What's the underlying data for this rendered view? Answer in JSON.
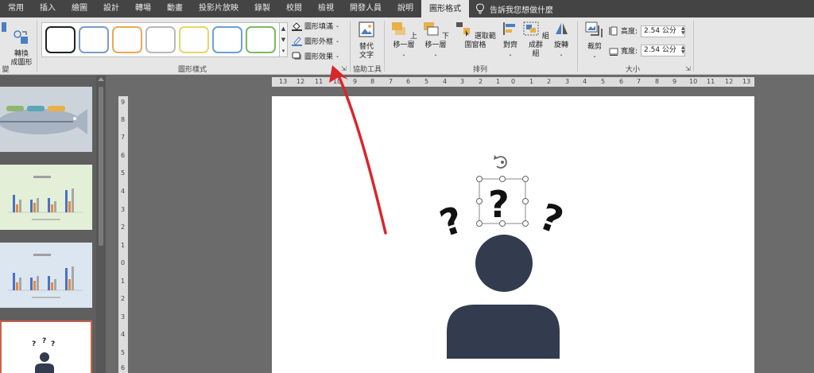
{
  "tabs": [
    {
      "label": "常用"
    },
    {
      "label": "插入"
    },
    {
      "label": "繪圖"
    },
    {
      "label": "設計"
    },
    {
      "label": "轉場"
    },
    {
      "label": "動畫"
    },
    {
      "label": "投影片放映"
    },
    {
      "label": "錄製"
    },
    {
      "label": "校閱"
    },
    {
      "label": "檢視"
    },
    {
      "label": "開發人員"
    },
    {
      "label": "說明"
    },
    {
      "label": "圖形格式",
      "active": true
    }
  ],
  "tell_me": "告訴我您想做什麼",
  "ribbon": {
    "convert_label": "轉換\n成圖形",
    "change_group_label": "變更",
    "gallery_swatch_colors": [
      "#222222",
      "#7a9cc6",
      "#e8a95a",
      "#b9b9b9",
      "#e8d56a",
      "#6da0d6",
      "#7db864"
    ],
    "shape_fill": "圖形填滿",
    "shape_outline": "圖形外框",
    "shape_effects": "圖形效果",
    "styles_group_label": "圖形樣式",
    "alt_text": "替代\n文字",
    "accessibility_group_label": "協助工具",
    "bring_forward": "上移一層",
    "send_backward": "下移一層",
    "selection_pane": "選取範圍窗格",
    "align": "對齊",
    "group": "組成群\n組",
    "rotate": "旋轉",
    "arrange_group_label": "排列",
    "crop": "裁剪",
    "height_label": "高度:",
    "height_value": "2.54 公分",
    "width_label": "寬度:",
    "width_value": "2.54 公分",
    "size_group_label": "大小"
  },
  "ruler": {
    "horizontal": [
      "13",
      "12",
      "11",
      "10",
      "9",
      "8",
      "7",
      "6",
      "5",
      "4",
      "3",
      "2",
      "1",
      "0",
      "1",
      "2",
      "3",
      "4",
      "5",
      "6",
      "7",
      "8",
      "9",
      "10",
      "11",
      "12",
      "13"
    ],
    "vertical": [
      "9",
      "8",
      "7",
      "6",
      "5",
      "4",
      "3",
      "2",
      "1",
      "0",
      "1",
      "2",
      "3",
      "4",
      "5",
      "6"
    ]
  },
  "slide": {
    "figure_color": "#333c4e",
    "question_mark": "?",
    "annotation_color": "#d9262c"
  },
  "thumbnails": [
    {
      "title": "",
      "bg": "#cdd3da"
    },
    {
      "title": "",
      "bg": "#e4efd8"
    },
    {
      "title": "",
      "bg": "#dbe6f1"
    },
    {
      "title": "",
      "bg": "#ffffff",
      "selected": true
    }
  ],
  "colors": {
    "tab_bar": "#444444",
    "ribbon": "#e6e6e6",
    "work_area": "#6b6b6b"
  }
}
